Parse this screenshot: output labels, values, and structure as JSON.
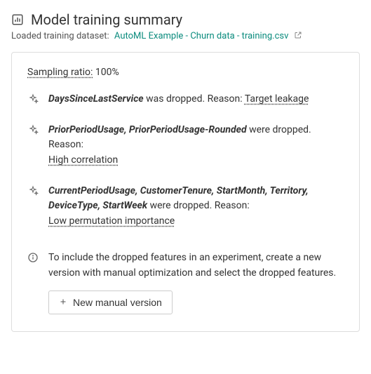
{
  "header": {
    "title": "Model training summary",
    "subtitle_prefix": "Loaded training dataset:",
    "dataset_name": "AutoML Example - Churn data - training.csv"
  },
  "sampling": {
    "label": "Sampling ratio:",
    "value": "100%"
  },
  "drops": [
    {
      "features": "DaysSinceLastService",
      "mid": " was dropped. Reason: ",
      "reason": "Target leakage",
      "inline_reason": true
    },
    {
      "features": "PriorPeriodUsage, PriorPeriodUsage-Rounded",
      "mid": " were dropped. Reason:",
      "reason": "High correlation",
      "inline_reason": false
    },
    {
      "features": "CurrentPeriodUsage, CustomerTenure, StartMonth, Territory, DeviceType, StartWeek",
      "mid": " were dropped. Reason:",
      "reason": "Low permutation importance",
      "inline_reason": false
    }
  ],
  "info": {
    "text": "To include the dropped features in an experiment, create a new version with manual optimization and select the dropped features.",
    "button_label": "New manual version"
  }
}
